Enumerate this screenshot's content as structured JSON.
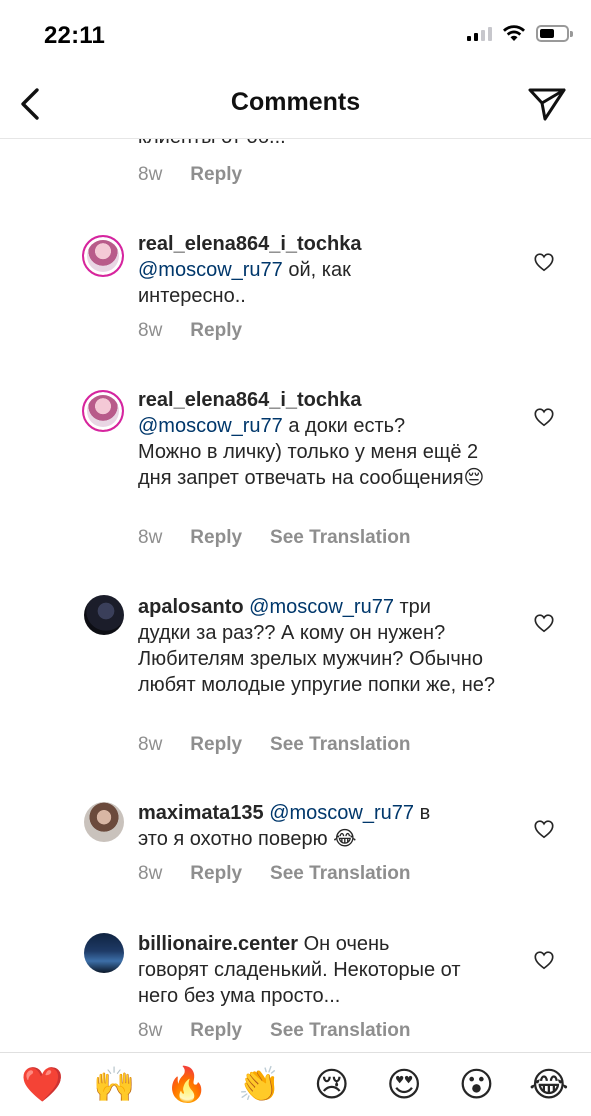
{
  "status_bar": {
    "time": "22:11"
  },
  "nav": {
    "title": "Comments"
  },
  "partial_comment": {
    "text": "клиенты от об...",
    "age": "8w",
    "reply_label": "Reply"
  },
  "comments": [
    {
      "username": "real_elena864_i_tochka",
      "mention": "@moscow_ru77",
      "line1": " ой, как",
      "rest": "интересно..",
      "age": "8w",
      "reply_label": "Reply"
    },
    {
      "username": "real_elena864_i_tochka",
      "mention": "@moscow_ru77",
      "line1": " а доки есть?",
      "rest": "Можно в личку) только у меня ещё 2 дня запрет отвечать на сообщения😔",
      "age": "8w",
      "reply_label": "Reply",
      "translate_label": "See Translation"
    },
    {
      "username": "apalosanto",
      "mention": "@moscow_ru77",
      "line1": " три",
      "rest": "дудки за раз?? А кому он нужен? Любителям зрелых мужчин? Обычно любят молодые упругие попки же, не?",
      "age": "8w",
      "reply_label": "Reply",
      "translate_label": "See Translation"
    },
    {
      "username": "maximata135",
      "mention": "@moscow_ru77",
      "line1": " в",
      "rest": "это я охотно поверю 😂",
      "age": "8w",
      "reply_label": "Reply",
      "translate_label": "See Translation"
    },
    {
      "username": "billionaire.center",
      "mention": "",
      "line1": " Он очень",
      "rest": "говорят сладенький.  Некоторые от него без ума просто...",
      "age": "8w",
      "reply_label": "Reply",
      "translate_label": "See Translation"
    }
  ],
  "emoji_bar": [
    "❤️",
    "🙌",
    "🔥",
    "👏",
    "😢",
    "😍",
    "😮",
    "😂"
  ]
}
